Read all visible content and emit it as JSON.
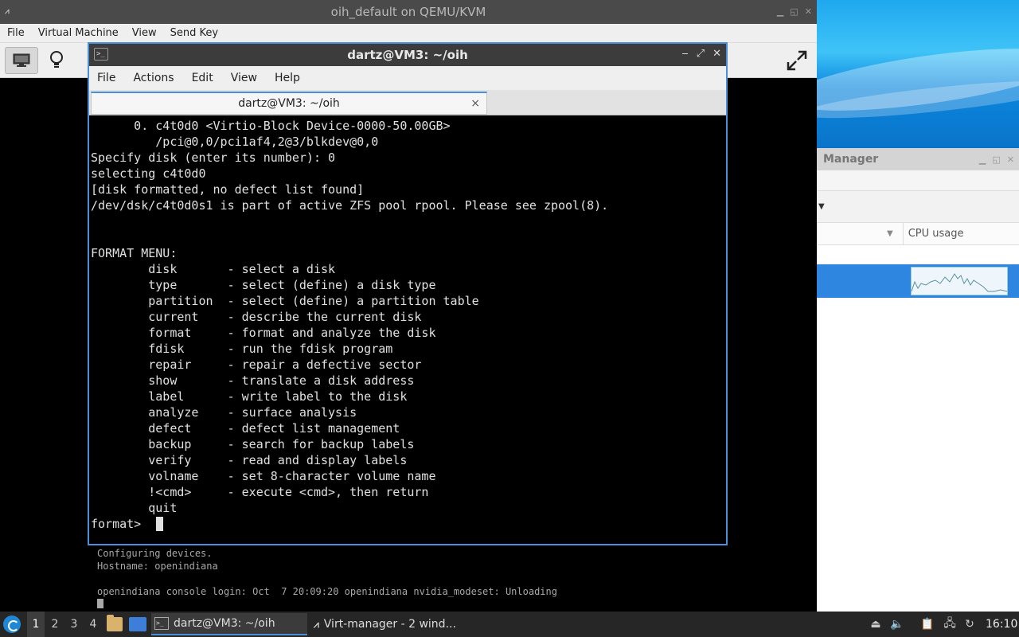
{
  "vm_window": {
    "title": "oih_default on QEMU/KVM",
    "menu": [
      "File",
      "Virtual Machine",
      "View",
      "Send Key"
    ],
    "console_lines": [
      "Configuring devices.",
      "Hostname: openindiana",
      "",
      "openindiana console login: Oct  7 20:09:20 openindiana nvidia_modeset: Unloading"
    ]
  },
  "terminal": {
    "title": "dartz@VM3: ~/oih",
    "menu": [
      "File",
      "Actions",
      "Edit",
      "View",
      "Help"
    ],
    "tab_label": "dartz@VM3: ~/oih",
    "tab_close": "×",
    "lines": [
      "      0. c4t0d0 <Virtio-Block Device-0000-50.00GB>",
      "         /pci@0,0/pci1af4,2@3/blkdev@0,0",
      "Specify disk (enter its number): 0",
      "selecting c4t0d0",
      "[disk formatted, no defect list found]",
      "/dev/dsk/c4t0d0s1 is part of active ZFS pool rpool. Please see zpool(8).",
      "",
      "",
      "FORMAT MENU:",
      "        disk       - select a disk",
      "        type       - select (define) a disk type",
      "        partition  - select (define) a partition table",
      "        current    - describe the current disk",
      "        format     - format and analyze the disk",
      "        fdisk      - run the fdisk program",
      "        repair     - repair a defective sector",
      "        show       - translate a disk address",
      "        label      - write label to the disk",
      "        analyze    - surface analysis",
      "        defect     - defect list management",
      "        backup     - search for backup labels",
      "        verify     - read and display labels",
      "        volname    - set 8-character volume name",
      "        !<cmd>     - execute <cmd>, then return",
      "        quit",
      "format> "
    ]
  },
  "manager": {
    "title": "Manager",
    "column_header": "CPU usage"
  },
  "taskbar": {
    "workspaces": [
      "1",
      "2",
      "3",
      "4"
    ],
    "active_workspace": "1",
    "tasks": [
      {
        "label": "dartz@VM3: ~/oih",
        "active": true
      },
      {
        "label": "Virt-manager - 2 wind...",
        "active": false
      }
    ],
    "clock": "16:10"
  },
  "colors": {
    "accent": "#4a90d9",
    "selection": "#2f86e0"
  }
}
